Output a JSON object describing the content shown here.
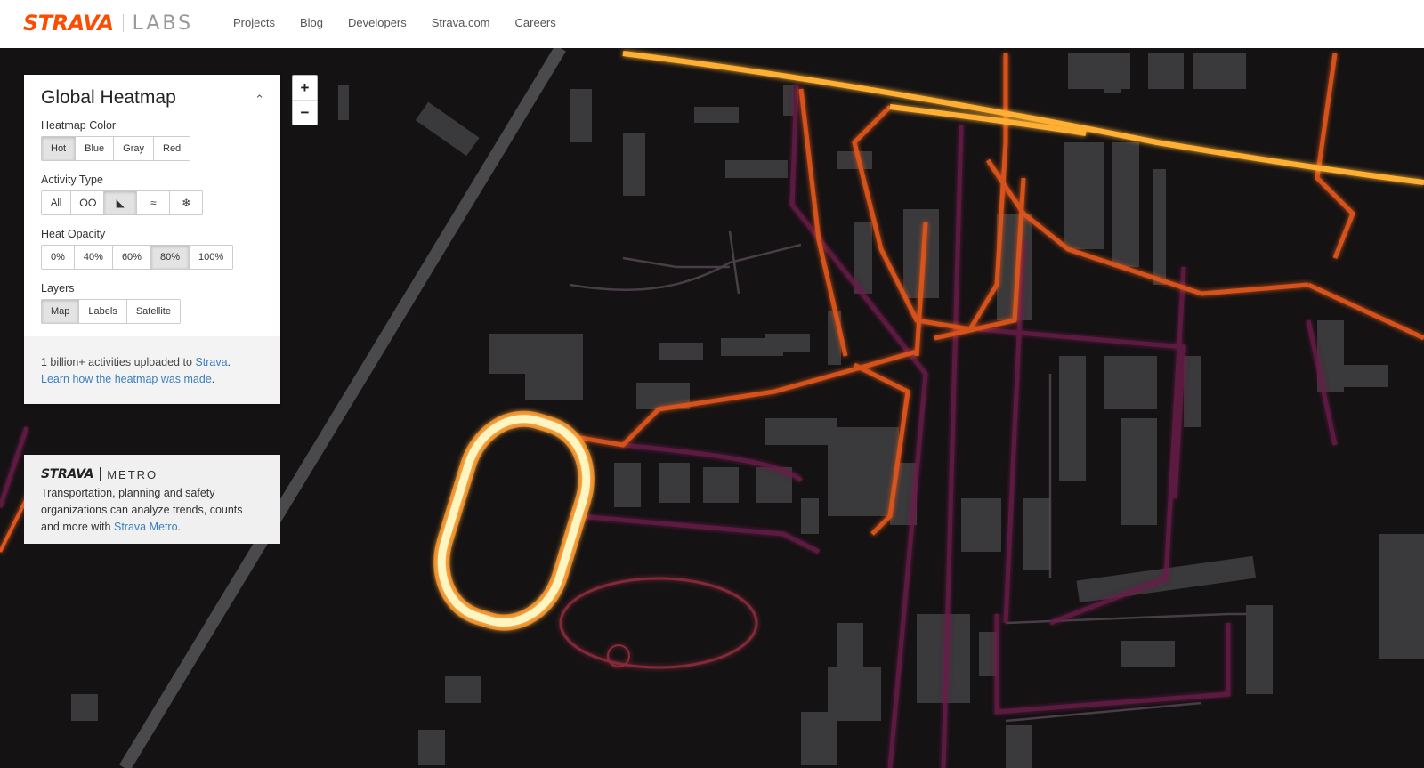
{
  "header": {
    "logo_text": "STRAVA",
    "logo_sub": "LABS",
    "nav": [
      "Projects",
      "Blog",
      "Developers",
      "Strava.com",
      "Careers"
    ],
    "brand_color": "#fc4c02"
  },
  "panel": {
    "title": "Global Heatmap",
    "collapse_icon": "chevron-up-icon",
    "heatmap_color": {
      "label": "Heatmap Color",
      "options": [
        "Hot",
        "Blue",
        "Gray",
        "Red"
      ],
      "selected": "Hot"
    },
    "activity_type": {
      "label": "Activity Type",
      "all_label": "All",
      "icons": [
        "bike-icon",
        "run-shoe-icon",
        "water-icon",
        "winter-icon"
      ],
      "selected": "run-shoe-icon"
    },
    "heat_opacity": {
      "label": "Heat Opacity",
      "options": [
        "0%",
        "40%",
        "60%",
        "80%",
        "100%"
      ],
      "selected": "80%"
    },
    "layers": {
      "label": "Layers",
      "options": [
        "Map",
        "Labels",
        "Satellite"
      ],
      "selected": "Map"
    },
    "footer": {
      "text1": "1 billion+ activities uploaded to ",
      "link1": "Strava",
      "text1_end": ".",
      "link2": "Learn how the heatmap was made",
      "text2_end": "."
    }
  },
  "metro": {
    "logo_text": "STRAVA",
    "logo_sub": "METRO",
    "text": "Transportation, planning and safety organizations can analyze trends, counts and more with ",
    "link": "Strava Metro",
    "text_end": "."
  },
  "zoom": {
    "in_label": "+",
    "out_label": "−"
  }
}
